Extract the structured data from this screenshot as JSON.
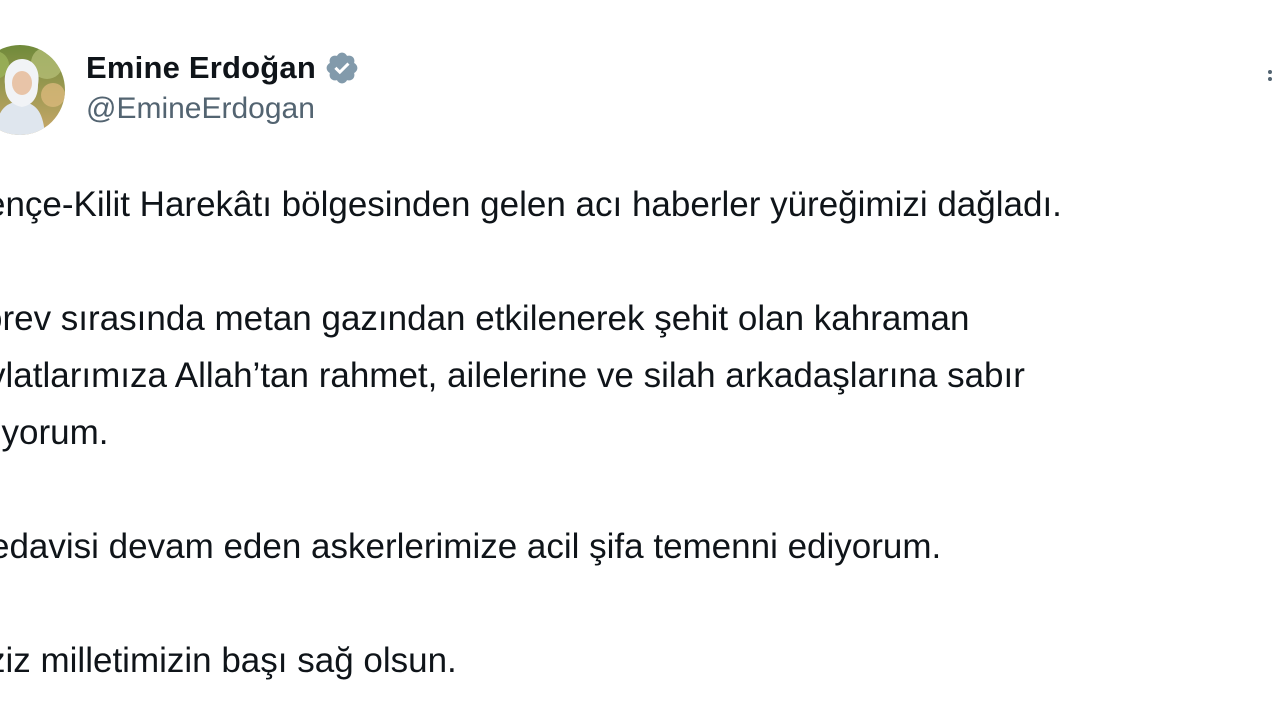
{
  "author": {
    "display_name": "Emine Erdoğan",
    "handle": "@EmineErdogan",
    "verified": true,
    "avatar_icon": "profile-photo",
    "verified_icon": "verified-badge-icon",
    "verified_color": "#829aab"
  },
  "tweet": {
    "lines": [
      "ençe-Kilit Harekâtı bölgesinden gelen acı haberler yüreğimizi dağladı.",
      "örev sırasında metan gazından etkilenerek şehit olan kahraman",
      "vlatlarımıza Allah’tan rahmet, ailelerine ve silah arkadaşlarına sabır",
      "liyorum.",
      "edavisi devam eden askerlerimize acil şifa temenni ediyorum.",
      "ziz milletimizin başı sağ olsun."
    ]
  },
  "menu": {
    "more_icon": "more-options-icon"
  },
  "colors": {
    "text": "#0f1419",
    "secondary_text": "#536471",
    "background": "#ffffff"
  }
}
